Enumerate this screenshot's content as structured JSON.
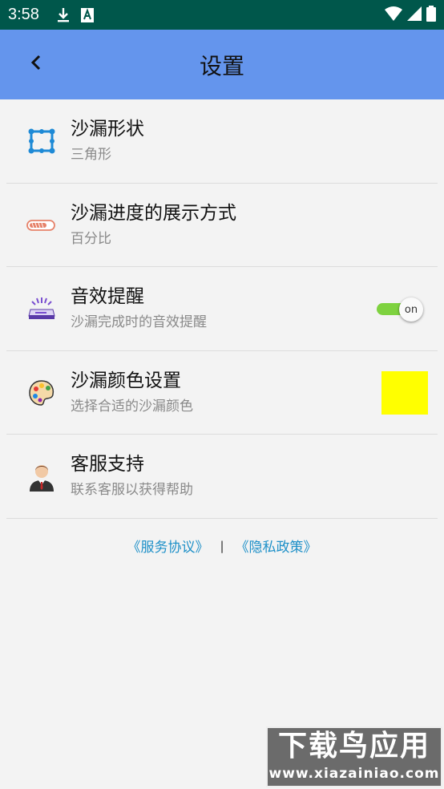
{
  "status_bar": {
    "time": "3:58",
    "icons": [
      "download-icon",
      "a-icon",
      "wifi-icon",
      "signal-icon",
      "battery-icon"
    ]
  },
  "toolbar": {
    "title": "设置",
    "back_icon": "chevron-left-icon",
    "color": "#6495ed"
  },
  "settings": [
    {
      "title": "沙漏形状",
      "subtitle": "三角形",
      "icon": "shape-icon"
    },
    {
      "title": "沙漏进度的展示方式",
      "subtitle": "百分比",
      "icon": "progress-bar-icon"
    },
    {
      "title": "音效提醒",
      "subtitle": "沙漏完成时的音效提醒",
      "icon": "sound-device-icon",
      "toggle_label": "on"
    },
    {
      "title": "沙漏颜色设置",
      "subtitle": "选择合适的沙漏颜色",
      "icon": "palette-icon",
      "color": "#ffff00"
    },
    {
      "title": "客服支持",
      "subtitle": "联系客服以获得帮助",
      "icon": "support-person-icon"
    }
  ],
  "footer": {
    "service_agreement": "《服务协议》",
    "separator": "|",
    "privacy_policy": "《隐私政策》"
  },
  "watermark": {
    "line1": "下载鸟应用",
    "line2": "www.xiazainiao.com"
  }
}
